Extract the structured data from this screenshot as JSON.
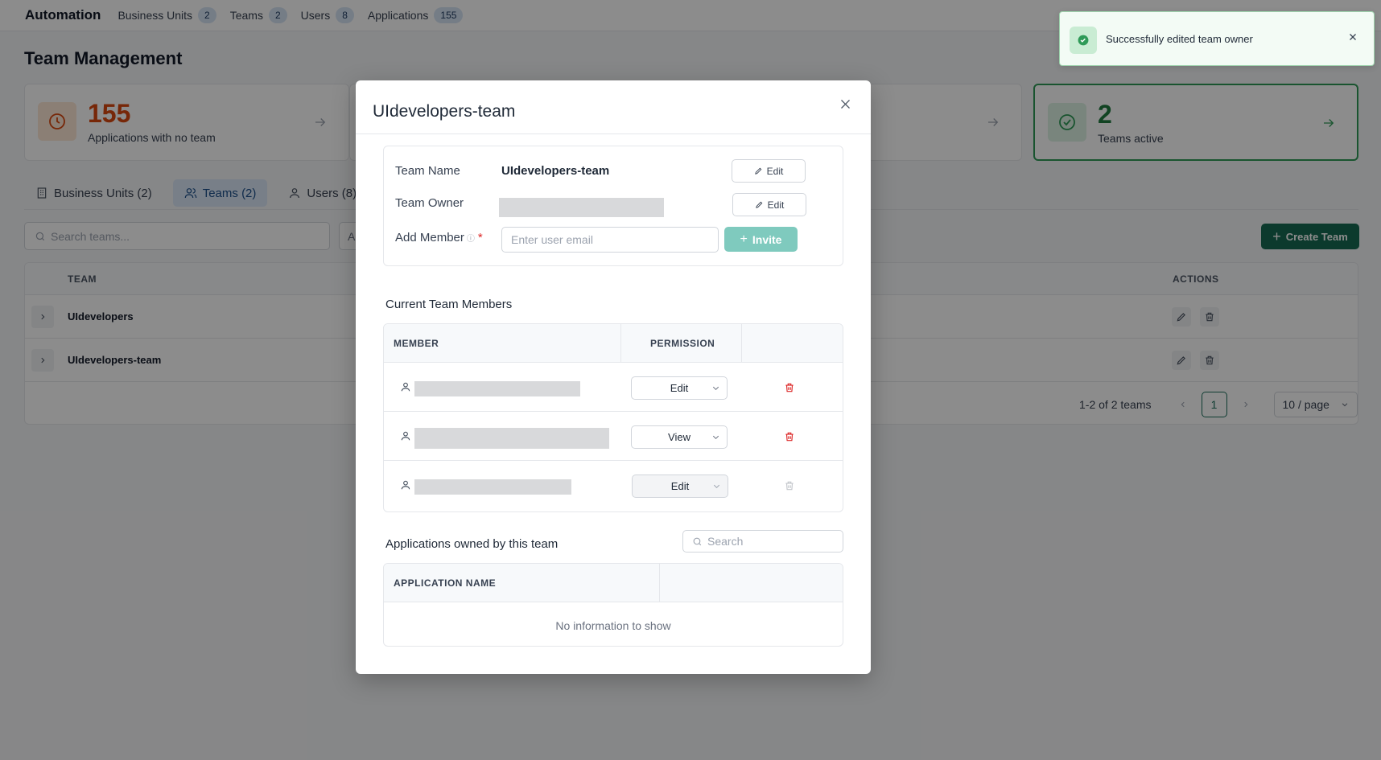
{
  "nav": {
    "brand": "Automation",
    "items": [
      {
        "label": "Business Units",
        "count": "2"
      },
      {
        "label": "Teams",
        "count": "2"
      },
      {
        "label": "Users",
        "count": "8"
      },
      {
        "label": "Applications",
        "count": "155"
      }
    ]
  },
  "page": {
    "title": "Team Management"
  },
  "stats": {
    "no_team": {
      "value": "155",
      "label": "Applications with no team"
    },
    "active": {
      "value": "2",
      "label": "Teams active"
    }
  },
  "subtabs": [
    {
      "label": "Business Units (2)"
    },
    {
      "label": "Teams (2)"
    },
    {
      "label": "Users (8)"
    }
  ],
  "toolbar": {
    "search_placeholder": "Search teams...",
    "filter_text": "A",
    "create_label": "Create Team"
  },
  "teams_table": {
    "columns": {
      "team": "TEAM",
      "actions": "ACTIONS"
    },
    "rows": [
      {
        "name": "UIdevelopers"
      },
      {
        "name": "UIdevelopers-team"
      }
    ],
    "pagination": {
      "range": "1-2 of 2 teams",
      "current": "1",
      "per_page": "10 / page"
    }
  },
  "toast": {
    "message": "Successfully edited team owner"
  },
  "modal": {
    "title": "UIdevelopers-team",
    "team_name_label": "Team Name",
    "team_name_value": "UIdevelopers-team",
    "team_owner_label": "Team Owner",
    "add_member_label": "Add Member",
    "required_mark": "*",
    "edit_label": "Edit",
    "email_placeholder": "Enter user email",
    "invite_label": "Invite",
    "members_title": "Current Team Members",
    "members_columns": {
      "member": "MEMBER",
      "permission": "PERMISSION"
    },
    "members": [
      {
        "permission": "Edit"
      },
      {
        "permission": "View"
      },
      {
        "permission": "Edit"
      }
    ],
    "apps_title": "Applications owned by this team",
    "apps_search_placeholder": "Search",
    "apps_columns": {
      "name": "APPLICATION NAME"
    },
    "apps_empty": "No information to show"
  },
  "colors": {
    "primary": "#166a52",
    "invite_disabled": "#7fcabe",
    "danger": "#dc2626",
    "success": "#2e9a57",
    "warning": "#d9480f"
  }
}
